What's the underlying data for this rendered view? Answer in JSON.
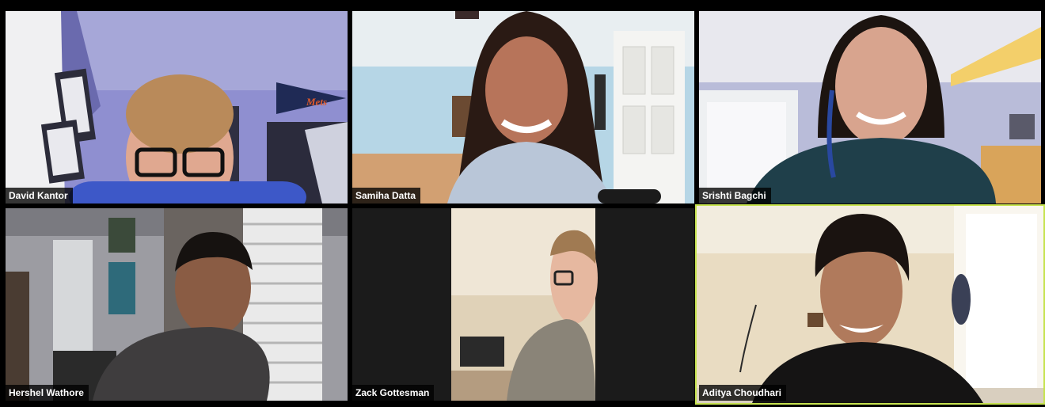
{
  "participants": [
    {
      "name": "David Kantor"
    },
    {
      "name": "Samiha Datta"
    },
    {
      "name": "Srishti Bagchi"
    },
    {
      "name": "Hershel Wathore"
    },
    {
      "name": "Zack Gottesman"
    },
    {
      "name": "Aditya Choudhari",
      "active_speaker": true
    }
  ],
  "pennant_text": "Mets",
  "colors": {
    "background": "#000000",
    "active_speaker_border": "#c6e34f",
    "name_label_bg": "#000000",
    "name_label_text": "#ffffff"
  }
}
